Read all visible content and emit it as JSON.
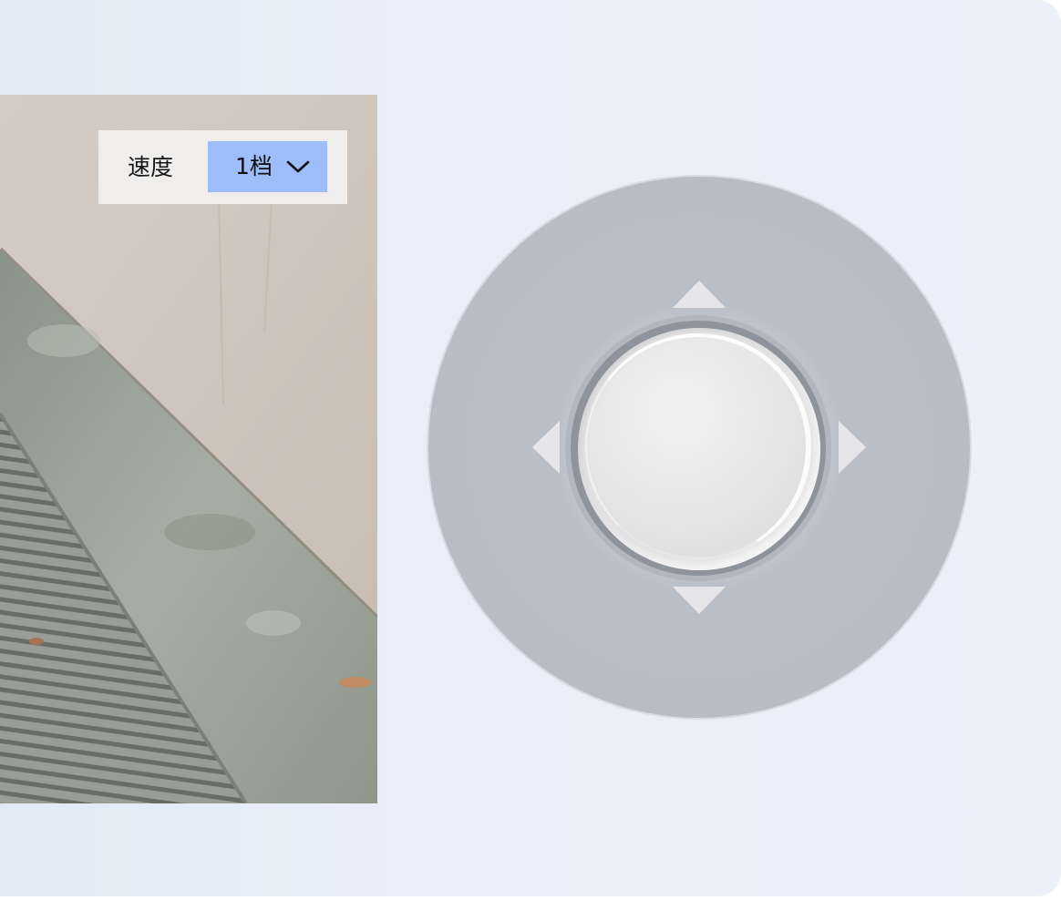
{
  "speed": {
    "label": "速度",
    "selected": "1档"
  },
  "colors": {
    "dropdown_bg": "#9dbefb",
    "dpad_base": "#b9bdc6",
    "knob": "#e7e7e8",
    "arrow": "#e6e6e8"
  },
  "icons": {
    "dropdown": "chevron-down-icon",
    "up": "arrow-up-icon",
    "down": "arrow-down-icon",
    "left": "arrow-left-icon",
    "right": "arrow-right-icon"
  }
}
